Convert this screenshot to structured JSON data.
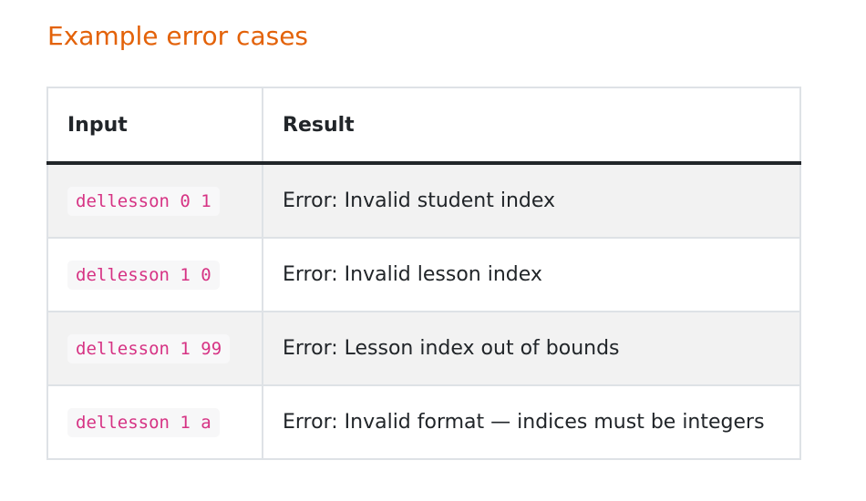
{
  "heading": "Example error cases",
  "table": {
    "headers": [
      "Input",
      "Result"
    ],
    "rows": [
      {
        "input": "dellesson 0 1",
        "result": "Error: Invalid student index"
      },
      {
        "input": "dellesson 1 0",
        "result": "Error: Invalid lesson index"
      },
      {
        "input": "dellesson 1 99",
        "result": "Error: Lesson index out of bounds"
      },
      {
        "input": "dellesson 1 a",
        "result": "Error: Invalid format — indices must be integers"
      }
    ]
  },
  "colors": {
    "heading": "#e36209",
    "code_text": "#d63384",
    "stripe": "#f2f2f2",
    "header_rule": "#212529"
  }
}
